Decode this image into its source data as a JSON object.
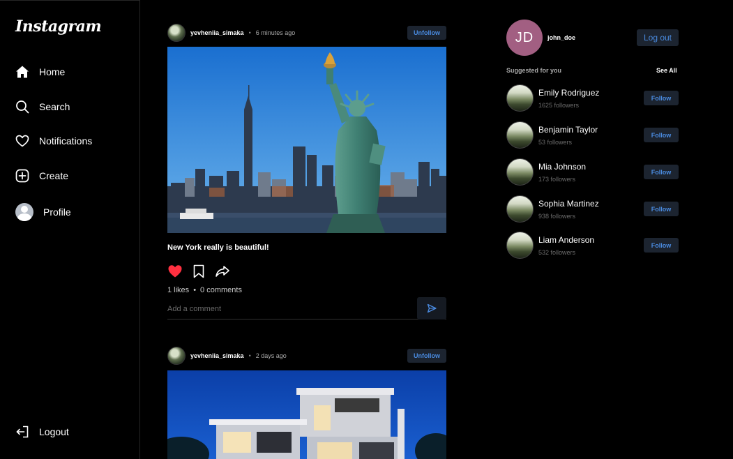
{
  "app": {
    "logo_text": "Instagram"
  },
  "sidebar": {
    "items": [
      {
        "label": "Home",
        "icon": "home-icon"
      },
      {
        "label": "Search",
        "icon": "search-icon"
      },
      {
        "label": "Notifications",
        "icon": "heart-icon"
      },
      {
        "label": "Create",
        "icon": "plus-square-icon"
      },
      {
        "label": "Profile",
        "icon": "avatar-icon"
      }
    ],
    "logout_label": "Logout"
  },
  "feed": {
    "posts": [
      {
        "username": "yevheniia_simaka",
        "separator": "•",
        "time": "6 minutes ago",
        "unfollow_label": "Unfollow",
        "caption": "New York really is beautiful!",
        "likes": "1 likes",
        "stat_separator": "•",
        "comments": "0 comments",
        "comment_placeholder": "Add a comment"
      },
      {
        "username": "yevheniia_simaka",
        "separator": "•",
        "time": "2 days ago",
        "unfollow_label": "Unfollow"
      }
    ]
  },
  "profile": {
    "initials": "JD",
    "username": "john_doe",
    "logout_label": "Log out"
  },
  "suggestions": {
    "title": "Suggested for you",
    "see_all": "See All",
    "follow_label": "Follow",
    "users": [
      {
        "name": "Emily Rodriguez",
        "followers": "1625 followers"
      },
      {
        "name": "Benjamin Taylor",
        "followers": "53 followers"
      },
      {
        "name": "Mia Johnson",
        "followers": "173 followers"
      },
      {
        "name": "Sophia Martinez",
        "followers": "938 followers"
      },
      {
        "name": "Liam Anderson",
        "followers": "532 followers"
      }
    ]
  },
  "colors": {
    "background": "#000000",
    "accent_blue": "#4a8be0",
    "button_bg": "#1c2430",
    "like_red": "#ff3040",
    "profile_avatar": "#a25f82"
  }
}
